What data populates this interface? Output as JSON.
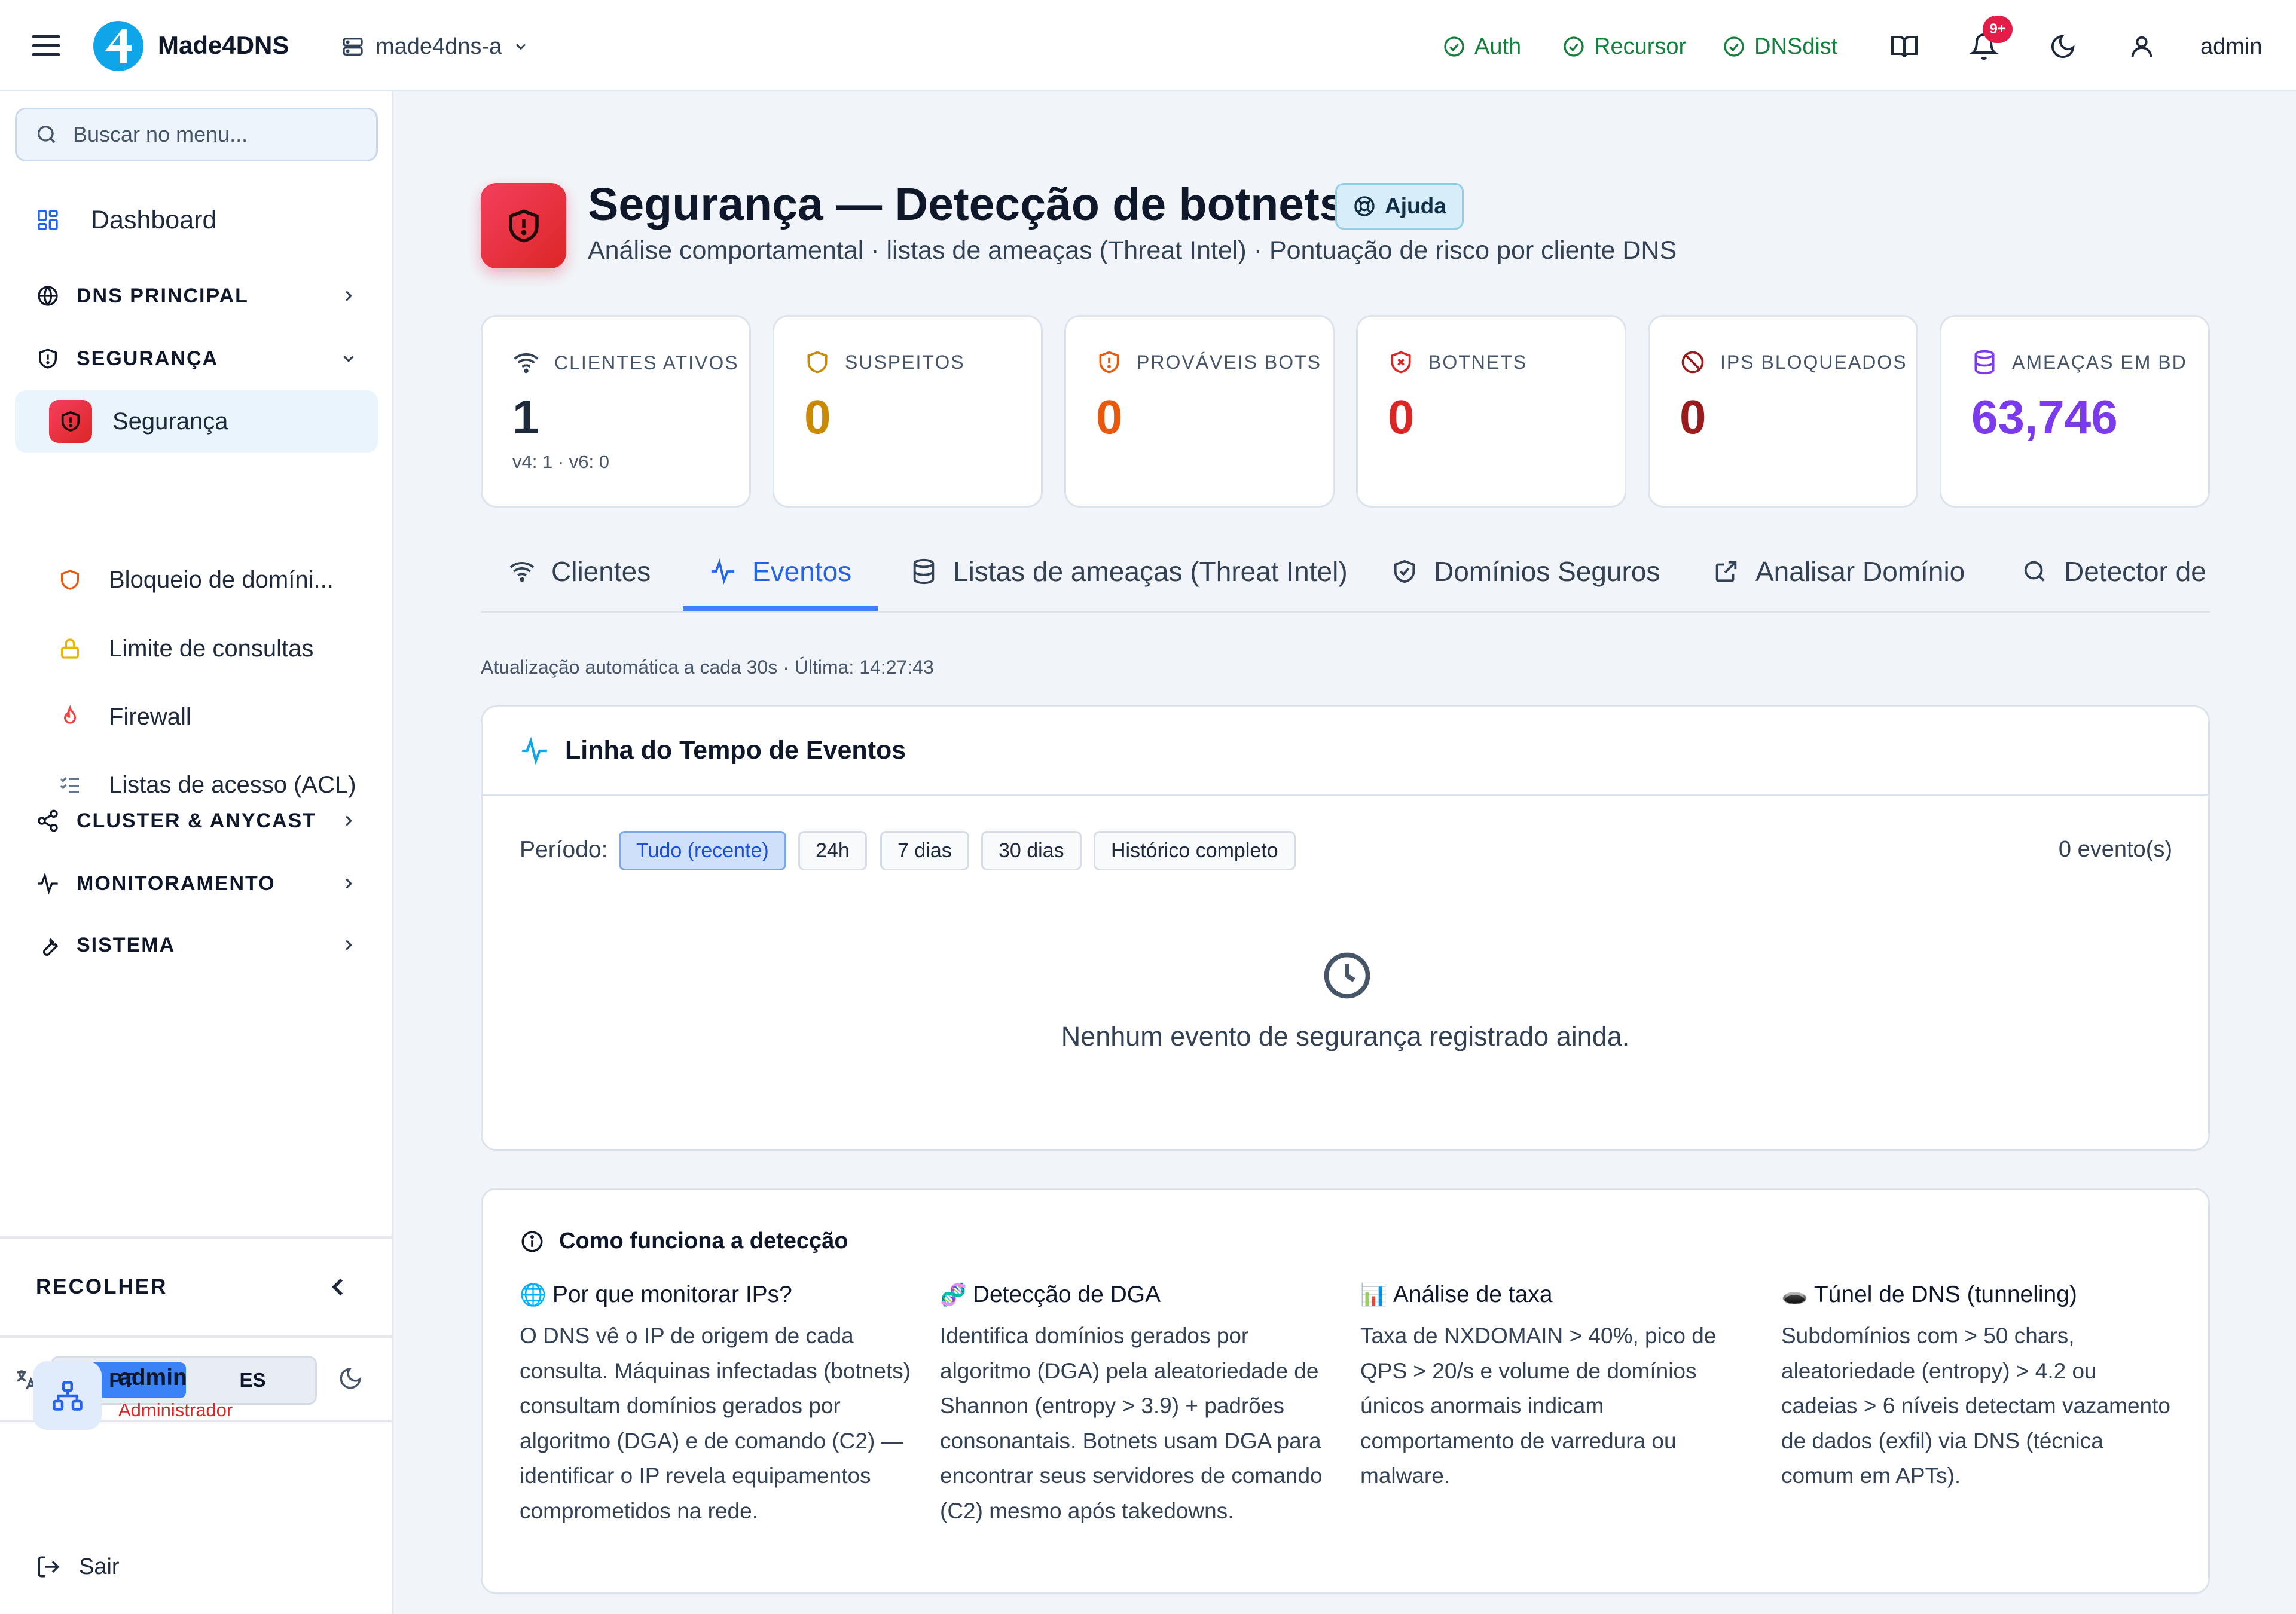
{
  "topbar": {
    "brand": "Made4DNS",
    "server": "made4dns-a",
    "services": [
      "Auth",
      "Recursor",
      "DNSdist"
    ],
    "notifications_badge": "9+",
    "user": "admin",
    "colors": {
      "ok": "#15803d",
      "badge": "#e11d48"
    }
  },
  "sidebar": {
    "search_placeholder": "Buscar no menu...",
    "dashboard": "Dashboard",
    "groups": {
      "dns": "DNS PRINCIPAL",
      "security": "SEGURANÇA",
      "cluster": "CLUSTER & ANYCAST",
      "monitoring": "MONITORAMENTO",
      "system": "SISTEMA"
    },
    "security_items": [
      {
        "label": "Segurança",
        "icon": "shield-alert-icon",
        "active": true
      },
      {
        "label": "Bloqueio de domíni...",
        "icon": "shield-icon"
      },
      {
        "label": "Limite de consultas",
        "icon": "lock-icon"
      },
      {
        "label": "Firewall",
        "icon": "flame-icon"
      },
      {
        "label": "Listas de acesso (ACL)",
        "icon": "list-checks-icon"
      }
    ],
    "collapse": "RECOLHER",
    "languages": [
      "PT",
      "ES"
    ],
    "active_language": "PT",
    "user": {
      "name": "admin",
      "role": "Administrador"
    },
    "logout": "Sair"
  },
  "page": {
    "title": "Segurança — Detecção de botnets",
    "help": "Ajuda",
    "subtitle": "Análise comportamental · listas de ameaças (Threat Intel) · Pontuação de risco por cliente DNS"
  },
  "stats": [
    {
      "label": "CLIENTES ATIVOS",
      "value": "1",
      "sub": "v4: 1 · v6: 0",
      "color": "#1e293b",
      "icon": "wifi-icon"
    },
    {
      "label": "SUSPEITOS",
      "value": "0",
      "color": "#ca8a04",
      "icon": "shield-icon"
    },
    {
      "label": "PROVÁVEIS BOTS",
      "value": "0",
      "color": "#ea580c",
      "icon": "shield-alert-icon"
    },
    {
      "label": "BOTNETS",
      "value": "0",
      "color": "#dc2626",
      "icon": "shield-x-icon"
    },
    {
      "label": "IPS BLOQUEADOS",
      "value": "0",
      "color": "#991b1b",
      "icon": "ban-icon"
    },
    {
      "label": "AMEAÇAS EM BD",
      "value": "63,746",
      "color": "#7c3aed",
      "icon": "database-icon"
    }
  ],
  "tabs": [
    {
      "label": "Clientes",
      "icon": "wifi-icon"
    },
    {
      "label": "Eventos",
      "icon": "activity-icon",
      "active": true
    },
    {
      "label": "Listas de ameaças (Threat Intel)",
      "icon": "database-icon"
    },
    {
      "label": "Domínios Seguros",
      "icon": "shield-check-icon"
    },
    {
      "label": "Analisar Domínio",
      "icon": "external-link-icon"
    },
    {
      "label": "Detector de",
      "icon": "search-icon"
    }
  ],
  "auto_update": "Atualização automática a cada 30s · Última: 14:27:43",
  "timeline": {
    "title": "Linha do Tempo de Eventos",
    "period_label": "Período:",
    "periods": [
      "Tudo (recente)",
      "24h",
      "7 dias",
      "30 dias",
      "Histórico completo"
    ],
    "active_period": "Tudo (recente)",
    "count": "0 evento(s)",
    "empty": "Nenhum evento de segurança registrado ainda."
  },
  "howto": {
    "title": "Como funciona a detecção",
    "columns": [
      {
        "emoji": "🌐",
        "title": "Por que monitorar IPs?",
        "text": "O DNS vê o IP de origem de cada consulta. Máquinas infectadas (botnets) consultam domínios gerados por algoritmo (DGA) e de comando (C2) — identificar o IP revela equipamentos comprometidos na rede."
      },
      {
        "emoji": "🧬",
        "title": "Detecção de DGA",
        "text": "Identifica domínios gerados por algoritmo (DGA) pela aleatoriedade de Shannon (entropy > 3.9) + padrões consonantais. Botnets usam DGA para encontrar seus servidores de comando (C2) mesmo após takedowns."
      },
      {
        "emoji": "📊",
        "title": "Análise de taxa",
        "text": "Taxa de NXDOMAIN > 40%, pico de QPS > 20/s e volume de domínios únicos anormais indicam comportamento de varredura ou malware."
      },
      {
        "emoji": "🕳️",
        "title": "Túnel de DNS (tunneling)",
        "text": "Subdomínios com > 50 chars, aleatoriedade (entropy) > 4.2 ou cadeias > 6 níveis detectam vazamento de dados (exfil) via DNS (técnica comum em APTs)."
      }
    ]
  }
}
